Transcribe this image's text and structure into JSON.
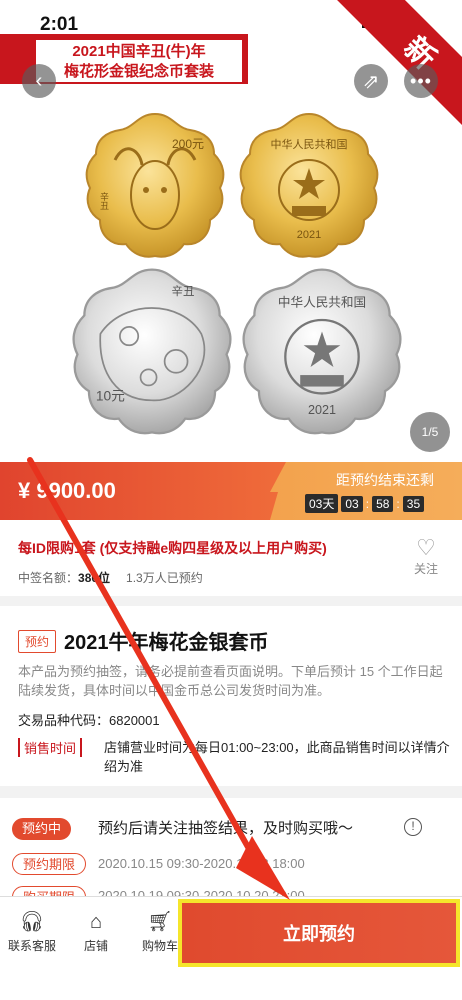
{
  "status_bar": {
    "time": "2:01"
  },
  "corner_ribbon": "新",
  "banner": {
    "line1": "2021中国辛丑(牛)年",
    "line2": "梅花形金银纪念币套装"
  },
  "gallery": {
    "counter": "1/5"
  },
  "coins": {
    "gold_front_value": "200元",
    "gold_front_year": "辛丑",
    "gold_back_text": "中华人民共和国",
    "gold_back_year": "2021",
    "silver_front_year": "辛丑",
    "silver_front_value": "10元",
    "silver_back_text": "中华人民共和国",
    "silver_back_year": "2021"
  },
  "price": {
    "text": "¥ 9900.00"
  },
  "countdown": {
    "label": "距预约结束还剩",
    "days": "03天",
    "hours": "03",
    "minutes": "58",
    "seconds": "35"
  },
  "purchase_limit": "每ID限购1套 (仅支持融e购四星级及以上用户购买)",
  "stats": {
    "quota_label": "中签名额：",
    "quota_value": "380位",
    "reserved": "1.3万人已预约"
  },
  "follow": {
    "label": "关注"
  },
  "product": {
    "badge": "预约",
    "title": "2021牛年梅花金银套币",
    "description": "本产品为预约抽签，请务必提前查看页面说明。下单后预计 15 个工作日起陆续发货，具体时间以中国金币总公司发货时间为准。",
    "code_label": "交易品种代码：",
    "code_value": "6820001",
    "sales_time_label": "销售时间",
    "sales_time_text": "店铺营业时间为每日01:00~23:00，此商品销售时间以详情介绍为准"
  },
  "reservation": {
    "status_badge": "预约中",
    "status_text": "预约后请关注抽签结果，及时购买哦～",
    "period_label": "预约期限",
    "period_value": "2020.10.15 09:30-2020.10.18 18:00",
    "buy_period_label": "购买期限",
    "buy_period_value": "2020.10.19 09:30-2020.10.20 23:00"
  },
  "bottom_bar": {
    "service_label": "联系客服",
    "store_label": "店铺",
    "cart_label": "购物车",
    "buy_label": "立即预约"
  },
  "colors": {
    "brand_red": "#c8161d",
    "accent_orange": "#e24a2e",
    "highlight_yellow": "#f5e52b"
  }
}
